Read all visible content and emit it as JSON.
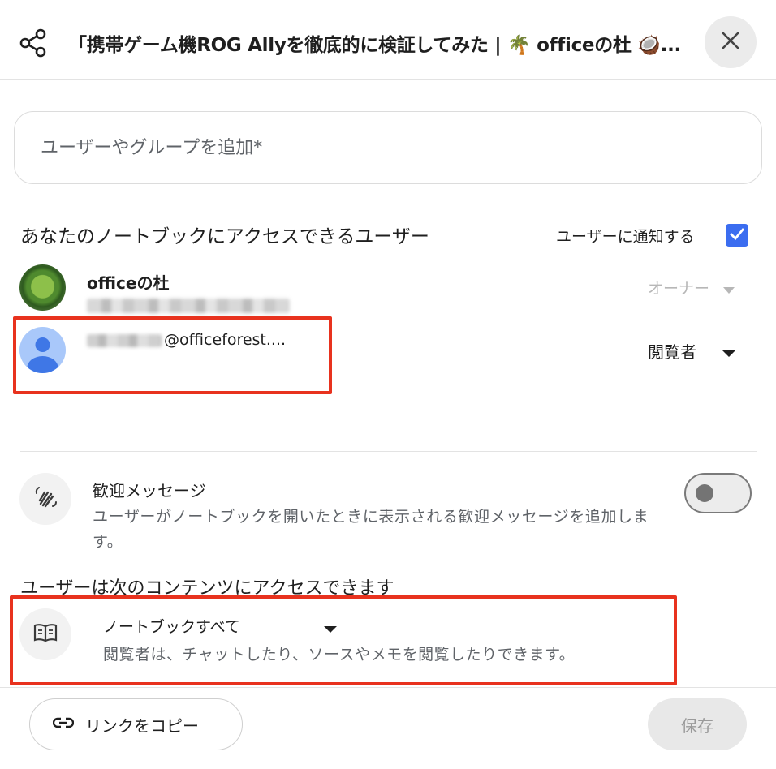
{
  "header": {
    "title": "「携帯ゲーム機ROG Allyを徹底的に検証してみた | 🌴 officeの杜 🥥..."
  },
  "add_people": {
    "placeholder": "ユーザーやグループを追加*"
  },
  "access": {
    "heading": "あなたのノートブックにアクセスできるユーザー",
    "notify_label": "ユーザーに通知する",
    "notify_checked": true,
    "users": [
      {
        "name": "officeの杜",
        "role": "オーナー"
      },
      {
        "email": "@officeforest....",
        "role": "閲覧者"
      }
    ]
  },
  "welcome": {
    "title": "歓迎メッセージ",
    "description": "ユーザーがノートブックを開いたときに表示される歓迎メッセージを追加します。",
    "enabled": false
  },
  "content_access": {
    "heading": "ユーザーは次のコンテンツにアクセスできます",
    "selected": "ノートブックすべて",
    "description": "閲覧者は、チャットしたり、ソースやメモを閲覧したりできます。"
  },
  "footer": {
    "copy_link_label": "リンクをコピー",
    "save_label": "保存"
  },
  "colors": {
    "accent": "#3b6df0",
    "highlight": "#e8321e"
  }
}
